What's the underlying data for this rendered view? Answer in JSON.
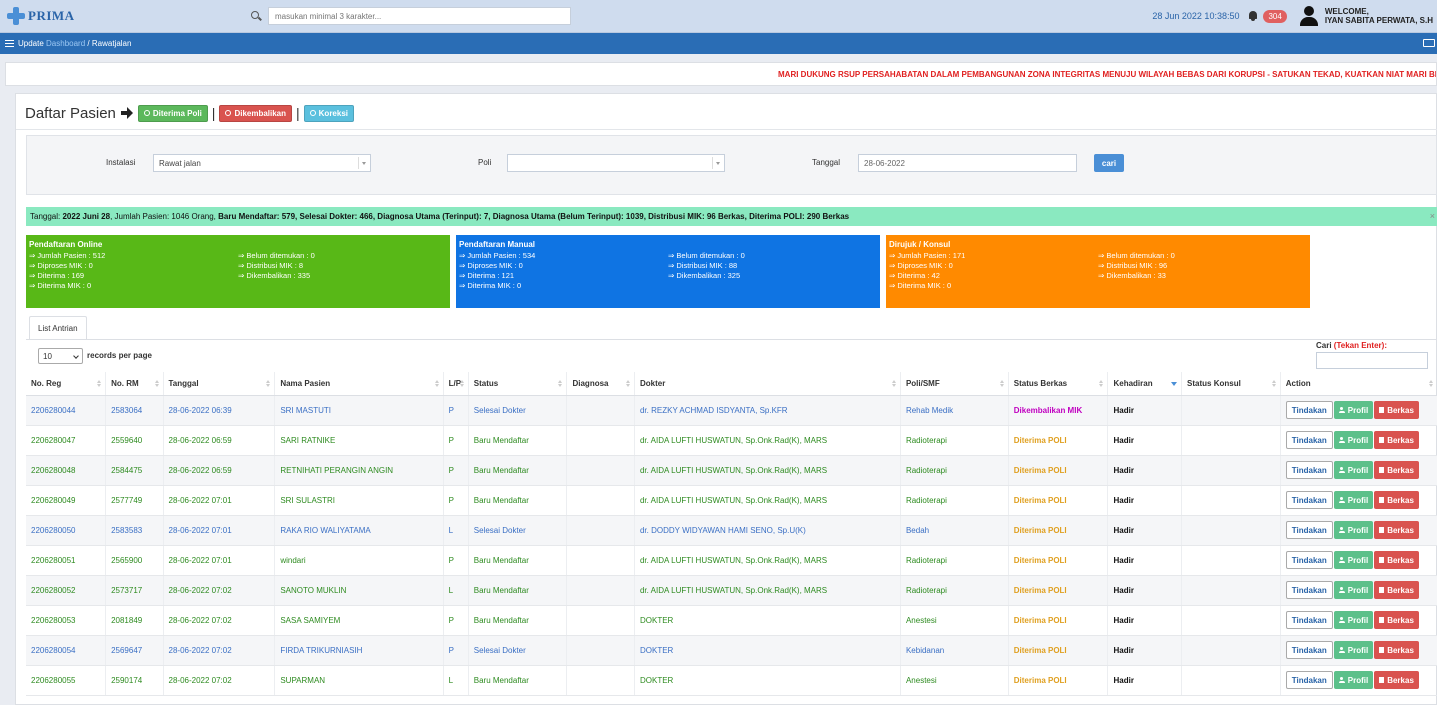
{
  "header": {
    "logo_text": "PRIMA",
    "search_placeholder": "masukan minimal 3 karakter...",
    "datetime": "28 Jun 2022 10:38:50",
    "notif_count": "304",
    "welcome_line1": "WELCOME,",
    "welcome_line2": "IYAN SABITA PERWATA, S.H"
  },
  "nav": {
    "label": "Update",
    "crumb_link": "Dashboard",
    "crumb_sep": "/",
    "crumb_current": "Rawatjalan"
  },
  "marquee": "MARI DUKUNG RSUP PERSAHABATAN DALAM PEMBANGUNAN ZONA INTEGRITAS MENUJU WILAYAH BEBAS DARI KORUPSI - SATUKAN TEKAD, KUATKAN NIAT MARI BE",
  "page": {
    "title": "Daftar Pasien",
    "btn_diterima": "Diterima Poli",
    "btn_dikembalikan": "Dikembalikan",
    "btn_koreksi": "Koreksi",
    "sep": "|"
  },
  "filter": {
    "instalasi_label": "Instalasi",
    "instalasi_value": "Rawat jalan",
    "poli_label": "Poli",
    "poli_value": "",
    "tanggal_label": "Tanggal",
    "tanggal_value": "28-06-2022",
    "cari_button": "cari"
  },
  "summary": {
    "p1": "Tanggal: ",
    "date": "2022 Juni 28",
    "p2": ", Jumlah Pasien: 1046 Orang, ",
    "rest": "Baru Mendaftar: 579, Selesai Dokter: 466, Diagnosa Utama (Terinput): 7, Diagnosa Utama (Belum Terinput): 1039, Distribusi MIK: 96 Berkas, Diterima POLI: 290 Berkas",
    "close": "×"
  },
  "cards": {
    "online": {
      "title": "Pendaftaran Online",
      "left": [
        "⇒ Jumlah Pasien : 512",
        "⇒ Diproses MIK : 0",
        "⇒ Diterima : 169",
        "⇒ Diterima MIK : 0"
      ],
      "right": [
        "⇒ Belum ditemukan : 0",
        "⇒ Distribusi MIK : 8",
        "⇒ Dikembalikan : 335"
      ]
    },
    "manual": {
      "title": "Pendaftaran Manual",
      "left": [
        "⇒ Jumlah Pasien : 534",
        "⇒ Diproses MIK : 0",
        "⇒ Diterima : 121",
        "⇒ Diterima MIK : 0"
      ],
      "right": [
        "⇒ Belum ditemukan : 0",
        "⇒ Distribusi MIK : 88",
        "⇒ Dikembalikan : 325"
      ]
    },
    "konsul": {
      "title": "Dirujuk / Konsul",
      "left": [
        "⇒ Jumlah Pasien : 171",
        "⇒ Diproses MIK : 0",
        "⇒ Diterima : 42",
        "⇒ Diterima MIK : 0"
      ],
      "right": [
        "⇒ Belum ditemukan : 0",
        "⇒ Distribusi MIK : 96",
        "⇒ Dikembalikan : 33"
      ]
    }
  },
  "tab_label": "List Antrian",
  "table_ctrl": {
    "rpp_value": "10",
    "rpp_label": "records per page",
    "cari_label": "Cari",
    "cari_hint": "(Tekan Enter):"
  },
  "table": {
    "columns": [
      "No. Reg",
      "No. RM",
      "Tanggal",
      "Nama Pasien",
      "L/P",
      "Status",
      "Diagnosa",
      "Dokter",
      "Poli/SMF",
      "Status Berkas",
      "Kehadiran",
      "Status Konsul",
      "Action"
    ],
    "action_labels": {
      "tindakan": "Tindakan",
      "profil": "Profil",
      "berkas": "Berkas"
    },
    "rows": [
      {
        "reg": "2206280044",
        "rm": "2583064",
        "tgl": "28-06-2022 06:39",
        "nama": "SRI MASTUTI",
        "lp": "P",
        "status": "Selesai Dokter",
        "diagnosa": "",
        "dokter": "dr. REZKY ACHMAD ISDYANTA, Sp.KFR",
        "poli": "Rehab Medik",
        "berkas": "Dikembalikan MIK",
        "hadir": "Hadir",
        "konsul": "",
        "color": "blue",
        "berkas_type": "mik"
      },
      {
        "reg": "2206280047",
        "rm": "2559640",
        "tgl": "28-06-2022 06:59",
        "nama": "SARI RATNIKE",
        "lp": "P",
        "status": "Baru Mendaftar",
        "diagnosa": "",
        "dokter": "dr. AIDA LUFTI HUSWATUN, Sp.Onk.Rad(K), MARS",
        "poli": "Radioterapi",
        "berkas": "Diterima POLI",
        "hadir": "Hadir",
        "konsul": "",
        "color": "green",
        "berkas_type": "poli"
      },
      {
        "reg": "2206280048",
        "rm": "2584475",
        "tgl": "28-06-2022 06:59",
        "nama": "RETNIHATI PERANGIN ANGIN",
        "lp": "P",
        "status": "Baru Mendaftar",
        "diagnosa": "",
        "dokter": "dr. AIDA LUFTI HUSWATUN, Sp.Onk.Rad(K), MARS",
        "poli": "Radioterapi",
        "berkas": "Diterima POLI",
        "hadir": "Hadir",
        "konsul": "",
        "color": "green",
        "berkas_type": "poli"
      },
      {
        "reg": "2206280049",
        "rm": "2577749",
        "tgl": "28-06-2022 07:01",
        "nama": "SRI SULASTRI",
        "lp": "P",
        "status": "Baru Mendaftar",
        "diagnosa": "",
        "dokter": "dr. AIDA LUFTI HUSWATUN, Sp.Onk.Rad(K), MARS",
        "poli": "Radioterapi",
        "berkas": "Diterima POLI",
        "hadir": "Hadir",
        "konsul": "",
        "color": "green",
        "berkas_type": "poli"
      },
      {
        "reg": "2206280050",
        "rm": "2583583",
        "tgl": "28-06-2022 07:01",
        "nama": "RAKA RIO WALIYATAMA",
        "lp": "L",
        "status": "Selesai Dokter",
        "diagnosa": "",
        "dokter": "dr. DODDY WIDYAWAN HAMI SENO, Sp.U(K)",
        "poli": "Bedah",
        "berkas": "Diterima POLI",
        "hadir": "Hadir",
        "konsul": "",
        "color": "blue",
        "berkas_type": "poli"
      },
      {
        "reg": "2206280051",
        "rm": "2565900",
        "tgl": "28-06-2022 07:01",
        "nama": "windari",
        "lp": "P",
        "status": "Baru Mendaftar",
        "diagnosa": "",
        "dokter": "dr. AIDA LUFTI HUSWATUN, Sp.Onk.Rad(K), MARS",
        "poli": "Radioterapi",
        "berkas": "Diterima POLI",
        "hadir": "Hadir",
        "konsul": "",
        "color": "green",
        "berkas_type": "poli"
      },
      {
        "reg": "2206280052",
        "rm": "2573717",
        "tgl": "28-06-2022 07:02",
        "nama": "SANOTO MUKLIN",
        "lp": "L",
        "status": "Baru Mendaftar",
        "diagnosa": "",
        "dokter": "dr. AIDA LUFTI HUSWATUN, Sp.Onk.Rad(K), MARS",
        "poli": "Radioterapi",
        "berkas": "Diterima POLI",
        "hadir": "Hadir",
        "konsul": "",
        "color": "green",
        "berkas_type": "poli"
      },
      {
        "reg": "2206280053",
        "rm": "2081849",
        "tgl": "28-06-2022 07:02",
        "nama": "SASA SAMIYEM",
        "lp": "P",
        "status": "Baru Mendaftar",
        "diagnosa": "",
        "dokter": "DOKTER",
        "poli": "Anestesi",
        "berkas": "Diterima POLI",
        "hadir": "Hadir",
        "konsul": "",
        "color": "green",
        "berkas_type": "poli"
      },
      {
        "reg": "2206280054",
        "rm": "2569647",
        "tgl": "28-06-2022 07:02",
        "nama": "FIRDA TRIKURNIASIH",
        "lp": "P",
        "status": "Selesai Dokter",
        "diagnosa": "",
        "dokter": "DOKTER",
        "poli": "Kebidanan",
        "berkas": "Diterima POLI",
        "hadir": "Hadir",
        "konsul": "",
        "color": "blue",
        "berkas_type": "poli"
      },
      {
        "reg": "2206280055",
        "rm": "2590174",
        "tgl": "28-06-2022 07:02",
        "nama": "SUPARMAN",
        "lp": "L",
        "status": "Baru Mendaftar",
        "diagnosa": "",
        "dokter": "DOKTER",
        "poli": "Anestesi",
        "berkas": "Diterima POLI",
        "hadir": "Hadir",
        "konsul": "",
        "color": "green",
        "berkas_type": "poli"
      }
    ]
  }
}
